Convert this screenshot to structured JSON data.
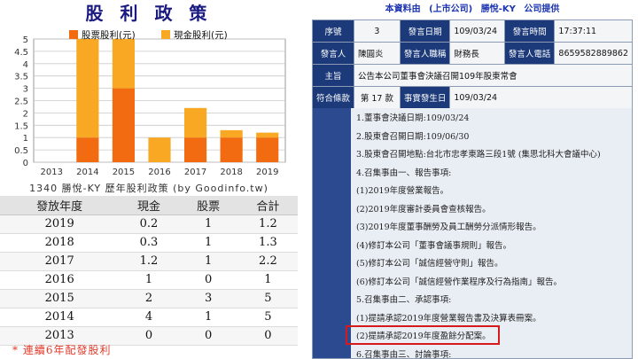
{
  "left": {
    "title": "股 利 政 策",
    "legend": {
      "stock": "股票股利(元)",
      "cash": "現金股利(元)"
    },
    "caption": "1340 勝悅-KY 歷年股利政策 (by Goodinfo.tw)",
    "table_headers": [
      "發放年度",
      "現金",
      "股票",
      "合計"
    ],
    "rows": [
      [
        "2019",
        "0.2",
        "1",
        "1.2"
      ],
      [
        "2018",
        "0.3",
        "1",
        "1.3"
      ],
      [
        "2017",
        "1.2",
        "1",
        "2.2"
      ],
      [
        "2016",
        "1",
        "0",
        "1"
      ],
      [
        "2015",
        "2",
        "3",
        "5"
      ],
      [
        "2014",
        "4",
        "1",
        "5"
      ],
      [
        "2013",
        "0",
        "0",
        "0"
      ]
    ],
    "note": "* 連續6年配發股利"
  },
  "chart_data": {
    "type": "bar",
    "stacked": true,
    "categories": [
      "2013",
      "2014",
      "2015",
      "2016",
      "2017",
      "2018",
      "2019"
    ],
    "series": [
      {
        "name": "股票股利(元)",
        "values": [
          0,
          1,
          3,
          0,
          1,
          1,
          1
        ]
      },
      {
        "name": "現金股利(元)",
        "values": [
          0,
          4,
          2,
          1,
          1.2,
          0.3,
          0.2
        ]
      }
    ],
    "ylim": [
      0,
      5
    ],
    "yticks": [
      "0",
      "0.5",
      "1",
      "1.5",
      "2",
      "2.5",
      "3",
      "3.5",
      "4",
      "4.5",
      "5"
    ],
    "grid": true,
    "legend_position": "top",
    "colors": {
      "stock": "#f26b10",
      "cash": "#f8a823"
    }
  },
  "right": {
    "header": {
      "prefix": "本資料由",
      "market": "(上市公司)",
      "company": "勝悅-KY",
      "suffix": "公司提供"
    },
    "meta": {
      "seq_label": "序號",
      "seq": "3",
      "date_label": "發言日期",
      "date": "109/03/24",
      "time_label": "發言時間",
      "time": "17:37:11",
      "speaker_label": "發言人",
      "speaker": "陳圓炎",
      "title_label": "發言人職稱",
      "title": "財務長",
      "phone_label": "發言人電話",
      "phone": "8659582889862",
      "subject_label": "主旨",
      "subject": "公告本公司董事會決議召開109年股東常會",
      "clause_label": "符合條款",
      "clause": "第 17 款",
      "event_date_label": "事實發生日",
      "event_date": "109/03/24"
    },
    "lines": [
      "1.董事會決議日期:109/03/24",
      "2.股東會召開日期:109/06/30",
      "3.股東會召開地點:台北市忠孝東路三段1號 (集思北科大會議中心)",
      "4.召集事由一、報告事項:",
      "(1)2019年度營業報告。",
      "(2)2019年度審計委員會查核報告。",
      "(3)2019年度董事酬勞及員工酬勞分派情形報告。",
      "(4)修訂本公司「董事會議事規則」報告。",
      "(5)修訂本公司「誠信經營守則」報告。",
      "(6)修訂本公司「誠信經營作業程序及行為指南」報告。",
      "5.召集事由二、承認事項:",
      "(1)提請承認2019年度營業報告書及決算表冊案。",
      "(2)提請承認2019年度盈餘分配案。",
      "6.召集事由三、討論事項:"
    ]
  }
}
